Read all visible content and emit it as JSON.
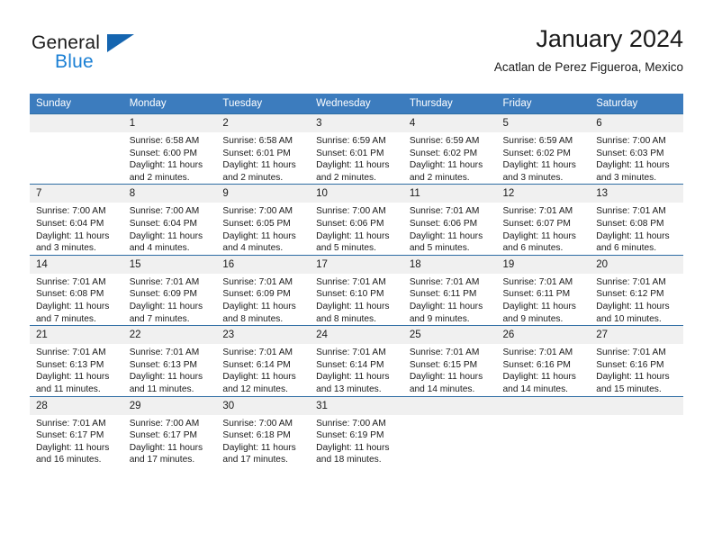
{
  "branding": {
    "logo_text_primary": "General",
    "logo_text_secondary": "Blue",
    "accent_blue": "#1a7fd4",
    "header_blue": "#3c7cbe",
    "divider_blue": "#2e6da4",
    "daynum_band": "#f0f0f0"
  },
  "header": {
    "title": "January 2024",
    "subtitle": "Acatlan de Perez Figueroa, Mexico"
  },
  "weekday_headers": [
    "Sunday",
    "Monday",
    "Tuesday",
    "Wednesday",
    "Thursday",
    "Friday",
    "Saturday"
  ],
  "weeks": [
    [
      {
        "day": "",
        "lines": []
      },
      {
        "day": "1",
        "lines": [
          "Sunrise: 6:58 AM",
          "Sunset: 6:00 PM",
          "Daylight: 11 hours",
          "and 2 minutes."
        ]
      },
      {
        "day": "2",
        "lines": [
          "Sunrise: 6:58 AM",
          "Sunset: 6:01 PM",
          "Daylight: 11 hours",
          "and 2 minutes."
        ]
      },
      {
        "day": "3",
        "lines": [
          "Sunrise: 6:59 AM",
          "Sunset: 6:01 PM",
          "Daylight: 11 hours",
          "and 2 minutes."
        ]
      },
      {
        "day": "4",
        "lines": [
          "Sunrise: 6:59 AM",
          "Sunset: 6:02 PM",
          "Daylight: 11 hours",
          "and 2 minutes."
        ]
      },
      {
        "day": "5",
        "lines": [
          "Sunrise: 6:59 AM",
          "Sunset: 6:02 PM",
          "Daylight: 11 hours",
          "and 3 minutes."
        ]
      },
      {
        "day": "6",
        "lines": [
          "Sunrise: 7:00 AM",
          "Sunset: 6:03 PM",
          "Daylight: 11 hours",
          "and 3 minutes."
        ]
      }
    ],
    [
      {
        "day": "7",
        "lines": [
          "Sunrise: 7:00 AM",
          "Sunset: 6:04 PM",
          "Daylight: 11 hours",
          "and 3 minutes."
        ]
      },
      {
        "day": "8",
        "lines": [
          "Sunrise: 7:00 AM",
          "Sunset: 6:04 PM",
          "Daylight: 11 hours",
          "and 4 minutes."
        ]
      },
      {
        "day": "9",
        "lines": [
          "Sunrise: 7:00 AM",
          "Sunset: 6:05 PM",
          "Daylight: 11 hours",
          "and 4 minutes."
        ]
      },
      {
        "day": "10",
        "lines": [
          "Sunrise: 7:00 AM",
          "Sunset: 6:06 PM",
          "Daylight: 11 hours",
          "and 5 minutes."
        ]
      },
      {
        "day": "11",
        "lines": [
          "Sunrise: 7:01 AM",
          "Sunset: 6:06 PM",
          "Daylight: 11 hours",
          "and 5 minutes."
        ]
      },
      {
        "day": "12",
        "lines": [
          "Sunrise: 7:01 AM",
          "Sunset: 6:07 PM",
          "Daylight: 11 hours",
          "and 6 minutes."
        ]
      },
      {
        "day": "13",
        "lines": [
          "Sunrise: 7:01 AM",
          "Sunset: 6:08 PM",
          "Daylight: 11 hours",
          "and 6 minutes."
        ]
      }
    ],
    [
      {
        "day": "14",
        "lines": [
          "Sunrise: 7:01 AM",
          "Sunset: 6:08 PM",
          "Daylight: 11 hours",
          "and 7 minutes."
        ]
      },
      {
        "day": "15",
        "lines": [
          "Sunrise: 7:01 AM",
          "Sunset: 6:09 PM",
          "Daylight: 11 hours",
          "and 7 minutes."
        ]
      },
      {
        "day": "16",
        "lines": [
          "Sunrise: 7:01 AM",
          "Sunset: 6:09 PM",
          "Daylight: 11 hours",
          "and 8 minutes."
        ]
      },
      {
        "day": "17",
        "lines": [
          "Sunrise: 7:01 AM",
          "Sunset: 6:10 PM",
          "Daylight: 11 hours",
          "and 8 minutes."
        ]
      },
      {
        "day": "18",
        "lines": [
          "Sunrise: 7:01 AM",
          "Sunset: 6:11 PM",
          "Daylight: 11 hours",
          "and 9 minutes."
        ]
      },
      {
        "day": "19",
        "lines": [
          "Sunrise: 7:01 AM",
          "Sunset: 6:11 PM",
          "Daylight: 11 hours",
          "and 9 minutes."
        ]
      },
      {
        "day": "20",
        "lines": [
          "Sunrise: 7:01 AM",
          "Sunset: 6:12 PM",
          "Daylight: 11 hours",
          "and 10 minutes."
        ]
      }
    ],
    [
      {
        "day": "21",
        "lines": [
          "Sunrise: 7:01 AM",
          "Sunset: 6:13 PM",
          "Daylight: 11 hours",
          "and 11 minutes."
        ]
      },
      {
        "day": "22",
        "lines": [
          "Sunrise: 7:01 AM",
          "Sunset: 6:13 PM",
          "Daylight: 11 hours",
          "and 11 minutes."
        ]
      },
      {
        "day": "23",
        "lines": [
          "Sunrise: 7:01 AM",
          "Sunset: 6:14 PM",
          "Daylight: 11 hours",
          "and 12 minutes."
        ]
      },
      {
        "day": "24",
        "lines": [
          "Sunrise: 7:01 AM",
          "Sunset: 6:14 PM",
          "Daylight: 11 hours",
          "and 13 minutes."
        ]
      },
      {
        "day": "25",
        "lines": [
          "Sunrise: 7:01 AM",
          "Sunset: 6:15 PM",
          "Daylight: 11 hours",
          "and 14 minutes."
        ]
      },
      {
        "day": "26",
        "lines": [
          "Sunrise: 7:01 AM",
          "Sunset: 6:16 PM",
          "Daylight: 11 hours",
          "and 14 minutes."
        ]
      },
      {
        "day": "27",
        "lines": [
          "Sunrise: 7:01 AM",
          "Sunset: 6:16 PM",
          "Daylight: 11 hours",
          "and 15 minutes."
        ]
      }
    ],
    [
      {
        "day": "28",
        "lines": [
          "Sunrise: 7:01 AM",
          "Sunset: 6:17 PM",
          "Daylight: 11 hours",
          "and 16 minutes."
        ]
      },
      {
        "day": "29",
        "lines": [
          "Sunrise: 7:00 AM",
          "Sunset: 6:17 PM",
          "Daylight: 11 hours",
          "and 17 minutes."
        ]
      },
      {
        "day": "30",
        "lines": [
          "Sunrise: 7:00 AM",
          "Sunset: 6:18 PM",
          "Daylight: 11 hours",
          "and 17 minutes."
        ]
      },
      {
        "day": "31",
        "lines": [
          "Sunrise: 7:00 AM",
          "Sunset: 6:19 PM",
          "Daylight: 11 hours",
          "and 18 minutes."
        ]
      },
      {
        "day": "",
        "lines": []
      },
      {
        "day": "",
        "lines": []
      },
      {
        "day": "",
        "lines": []
      }
    ]
  ]
}
